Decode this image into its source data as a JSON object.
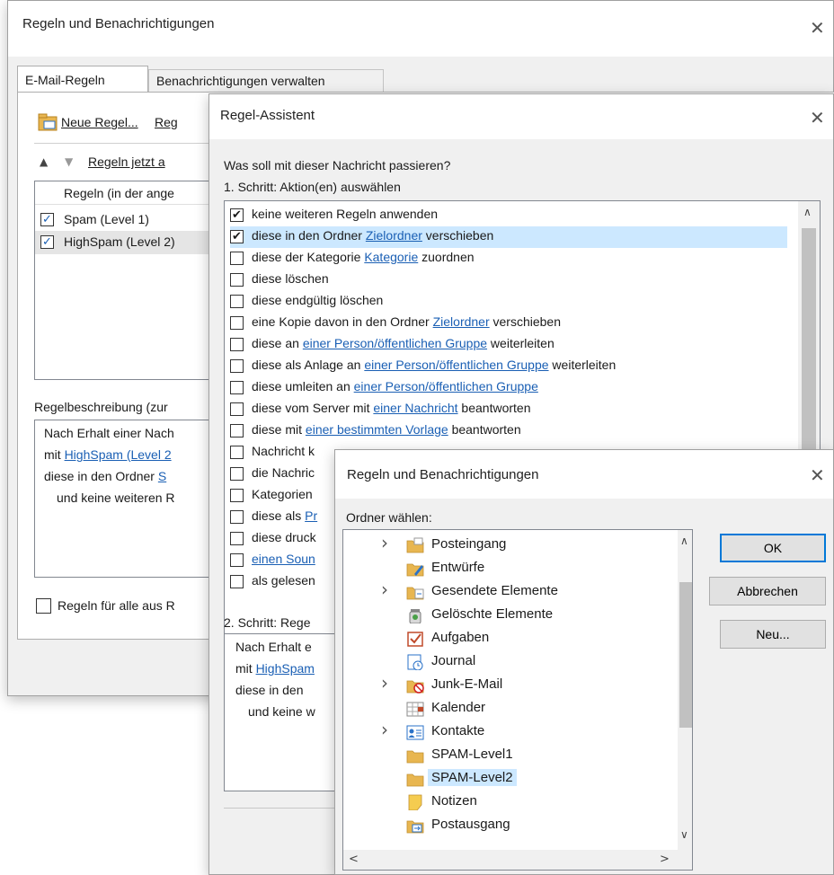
{
  "main_window": {
    "title": "Regeln und Benachrichtigungen",
    "tabs": [
      {
        "label": "E-Mail-Regeln",
        "active": true
      },
      {
        "label": "Benachrichtigungen verwalten",
        "active": false
      }
    ],
    "toolbar": {
      "new_rule": "Neue Regel...",
      "change_rule": "Reg",
      "run_rules": "Regeln jetzt a"
    },
    "rules_header": "Regeln (in der ange",
    "rules": [
      {
        "name": "Spam (Level 1)",
        "checked": true
      },
      {
        "name": "HighSpam (Level 2)",
        "checked": true
      }
    ],
    "description_label": "Regelbeschreibung (zur",
    "description": {
      "line1": "Nach Erhalt einer Nach",
      "line2_prefix": "mit ",
      "line2_link": "HighSpam (Level 2",
      "line3_prefix": "diese in den Ordner ",
      "line3_link": "S",
      "line4": "und keine weiteren R"
    },
    "apply_all": {
      "label": "Regeln für alle aus R",
      "checked": false
    }
  },
  "wizard": {
    "title": "Regel-Assistent",
    "question": "Was soll mit dieser Nachricht passieren?",
    "step1": "1. Schritt: Aktion(en) auswählen",
    "actions": [
      {
        "checked": true,
        "parts": [
          {
            "t": "keine weiteren Regeln anwenden"
          }
        ]
      },
      {
        "checked": true,
        "selected": true,
        "parts": [
          {
            "t": "diese in den Ordner "
          },
          {
            "t": "Zielordner",
            "link": true
          },
          {
            "t": " verschieben"
          }
        ]
      },
      {
        "checked": false,
        "parts": [
          {
            "t": "diese der Kategorie "
          },
          {
            "t": "Kategorie",
            "link": true
          },
          {
            "t": " zuordnen"
          }
        ]
      },
      {
        "checked": false,
        "parts": [
          {
            "t": "diese löschen"
          }
        ]
      },
      {
        "checked": false,
        "parts": [
          {
            "t": "diese endgültig löschen"
          }
        ]
      },
      {
        "checked": false,
        "parts": [
          {
            "t": "eine Kopie davon in den Ordner "
          },
          {
            "t": "Zielordner",
            "link": true
          },
          {
            "t": " verschieben"
          }
        ]
      },
      {
        "checked": false,
        "parts": [
          {
            "t": "diese an "
          },
          {
            "t": "einer Person/öffentlichen Gruppe",
            "link": true
          },
          {
            "t": " weiterleiten"
          }
        ]
      },
      {
        "checked": false,
        "parts": [
          {
            "t": "diese als Anlage an "
          },
          {
            "t": "einer Person/öffentlichen Gruppe",
            "link": true
          },
          {
            "t": " weiterleiten"
          }
        ]
      },
      {
        "checked": false,
        "parts": [
          {
            "t": "diese umleiten an "
          },
          {
            "t": "einer Person/öffentlichen Gruppe",
            "link": true
          }
        ]
      },
      {
        "checked": false,
        "parts": [
          {
            "t": "diese vom Server mit "
          },
          {
            "t": "einer Nachricht",
            "link": true
          },
          {
            "t": " beantworten"
          }
        ]
      },
      {
        "checked": false,
        "parts": [
          {
            "t": "diese mit "
          },
          {
            "t": "einer bestimmten Vorlage",
            "link": true
          },
          {
            "t": " beantworten"
          }
        ]
      },
      {
        "checked": false,
        "parts": [
          {
            "t": "Nachricht k"
          }
        ]
      },
      {
        "checked": false,
        "parts": [
          {
            "t": "die Nachric"
          }
        ]
      },
      {
        "checked": false,
        "parts": [
          {
            "t": "Kategorien"
          }
        ]
      },
      {
        "checked": false,
        "parts": [
          {
            "t": "diese als "
          },
          {
            "t": "Pr",
            "link": true
          }
        ]
      },
      {
        "checked": false,
        "parts": [
          {
            "t": "diese druck"
          }
        ]
      },
      {
        "checked": false,
        "parts": [
          {
            "t": "einen Soun",
            "link": true
          }
        ]
      },
      {
        "checked": false,
        "parts": [
          {
            "t": "als gelesen"
          }
        ]
      }
    ],
    "step2": "2. Schritt: Rege",
    "description": {
      "line1": "Nach Erhalt e",
      "line2_prefix": "mit ",
      "line2_link": "HighSpam",
      "line3": "diese in den",
      "line4": "und keine w"
    }
  },
  "folder_dialog": {
    "title": "Regeln und Benachrichtigungen",
    "label": "Ordner wählen:",
    "folders": [
      {
        "name": "Posteingang",
        "expandable": true,
        "icon": "inbox-icon"
      },
      {
        "name": "Entwürfe",
        "expandable": false,
        "icon": "drafts-icon"
      },
      {
        "name": "Gesendete Elemente",
        "expandable": true,
        "icon": "sent-items-icon"
      },
      {
        "name": "Gelöschte Elemente",
        "expandable": false,
        "icon": "trash-icon"
      },
      {
        "name": "Aufgaben",
        "expandable": false,
        "icon": "tasks-icon"
      },
      {
        "name": "Journal",
        "expandable": false,
        "icon": "journal-icon"
      },
      {
        "name": "Junk-E-Mail",
        "expandable": true,
        "icon": "junk-mail-icon"
      },
      {
        "name": "Kalender",
        "expandable": false,
        "icon": "calendar-icon"
      },
      {
        "name": "Kontakte",
        "expandable": true,
        "icon": "contacts-icon"
      },
      {
        "name": "SPAM-Level1",
        "expandable": false,
        "icon": "folder-icon"
      },
      {
        "name": "SPAM-Level2",
        "expandable": false,
        "icon": "folder-icon",
        "selected": true
      },
      {
        "name": "Notizen",
        "expandable": false,
        "icon": "notes-icon"
      },
      {
        "name": "Postausgang",
        "expandable": false,
        "icon": "outbox-icon"
      }
    ],
    "buttons": {
      "ok": "OK",
      "cancel": "Abbrechen",
      "new": "Neu..."
    }
  },
  "colors": {
    "link": "#1a5fb4",
    "selection": "#cce8ff",
    "accent": "#0078d7"
  }
}
